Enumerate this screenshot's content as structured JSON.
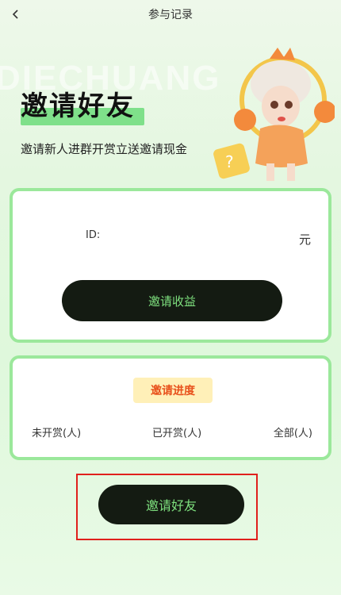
{
  "nav": {
    "title": "参与记录",
    "back_icon": "chevron-left-icon"
  },
  "hero": {
    "watermark": "DIECHUANG",
    "title": "邀请好友",
    "subtitle": "邀请新人进群开赏立送邀请现金"
  },
  "earnings_card": {
    "id_label": "ID:",
    "amount_unit": "元",
    "button_label": "邀请收益"
  },
  "progress_card": {
    "badge_label": "邀请进度",
    "stats": [
      {
        "label": "未开赏(人)"
      },
      {
        "label": "已开赏(人)"
      },
      {
        "label": "全部(人)"
      }
    ]
  },
  "invite_button": {
    "label": "邀请好友"
  },
  "colors": {
    "button_bg": "#141b12",
    "button_text": "#7ee07e",
    "card_border": "#9be89b",
    "badge_bg": "#fff0b8",
    "badge_text": "#e8511c",
    "highlight": "#e0201c"
  }
}
